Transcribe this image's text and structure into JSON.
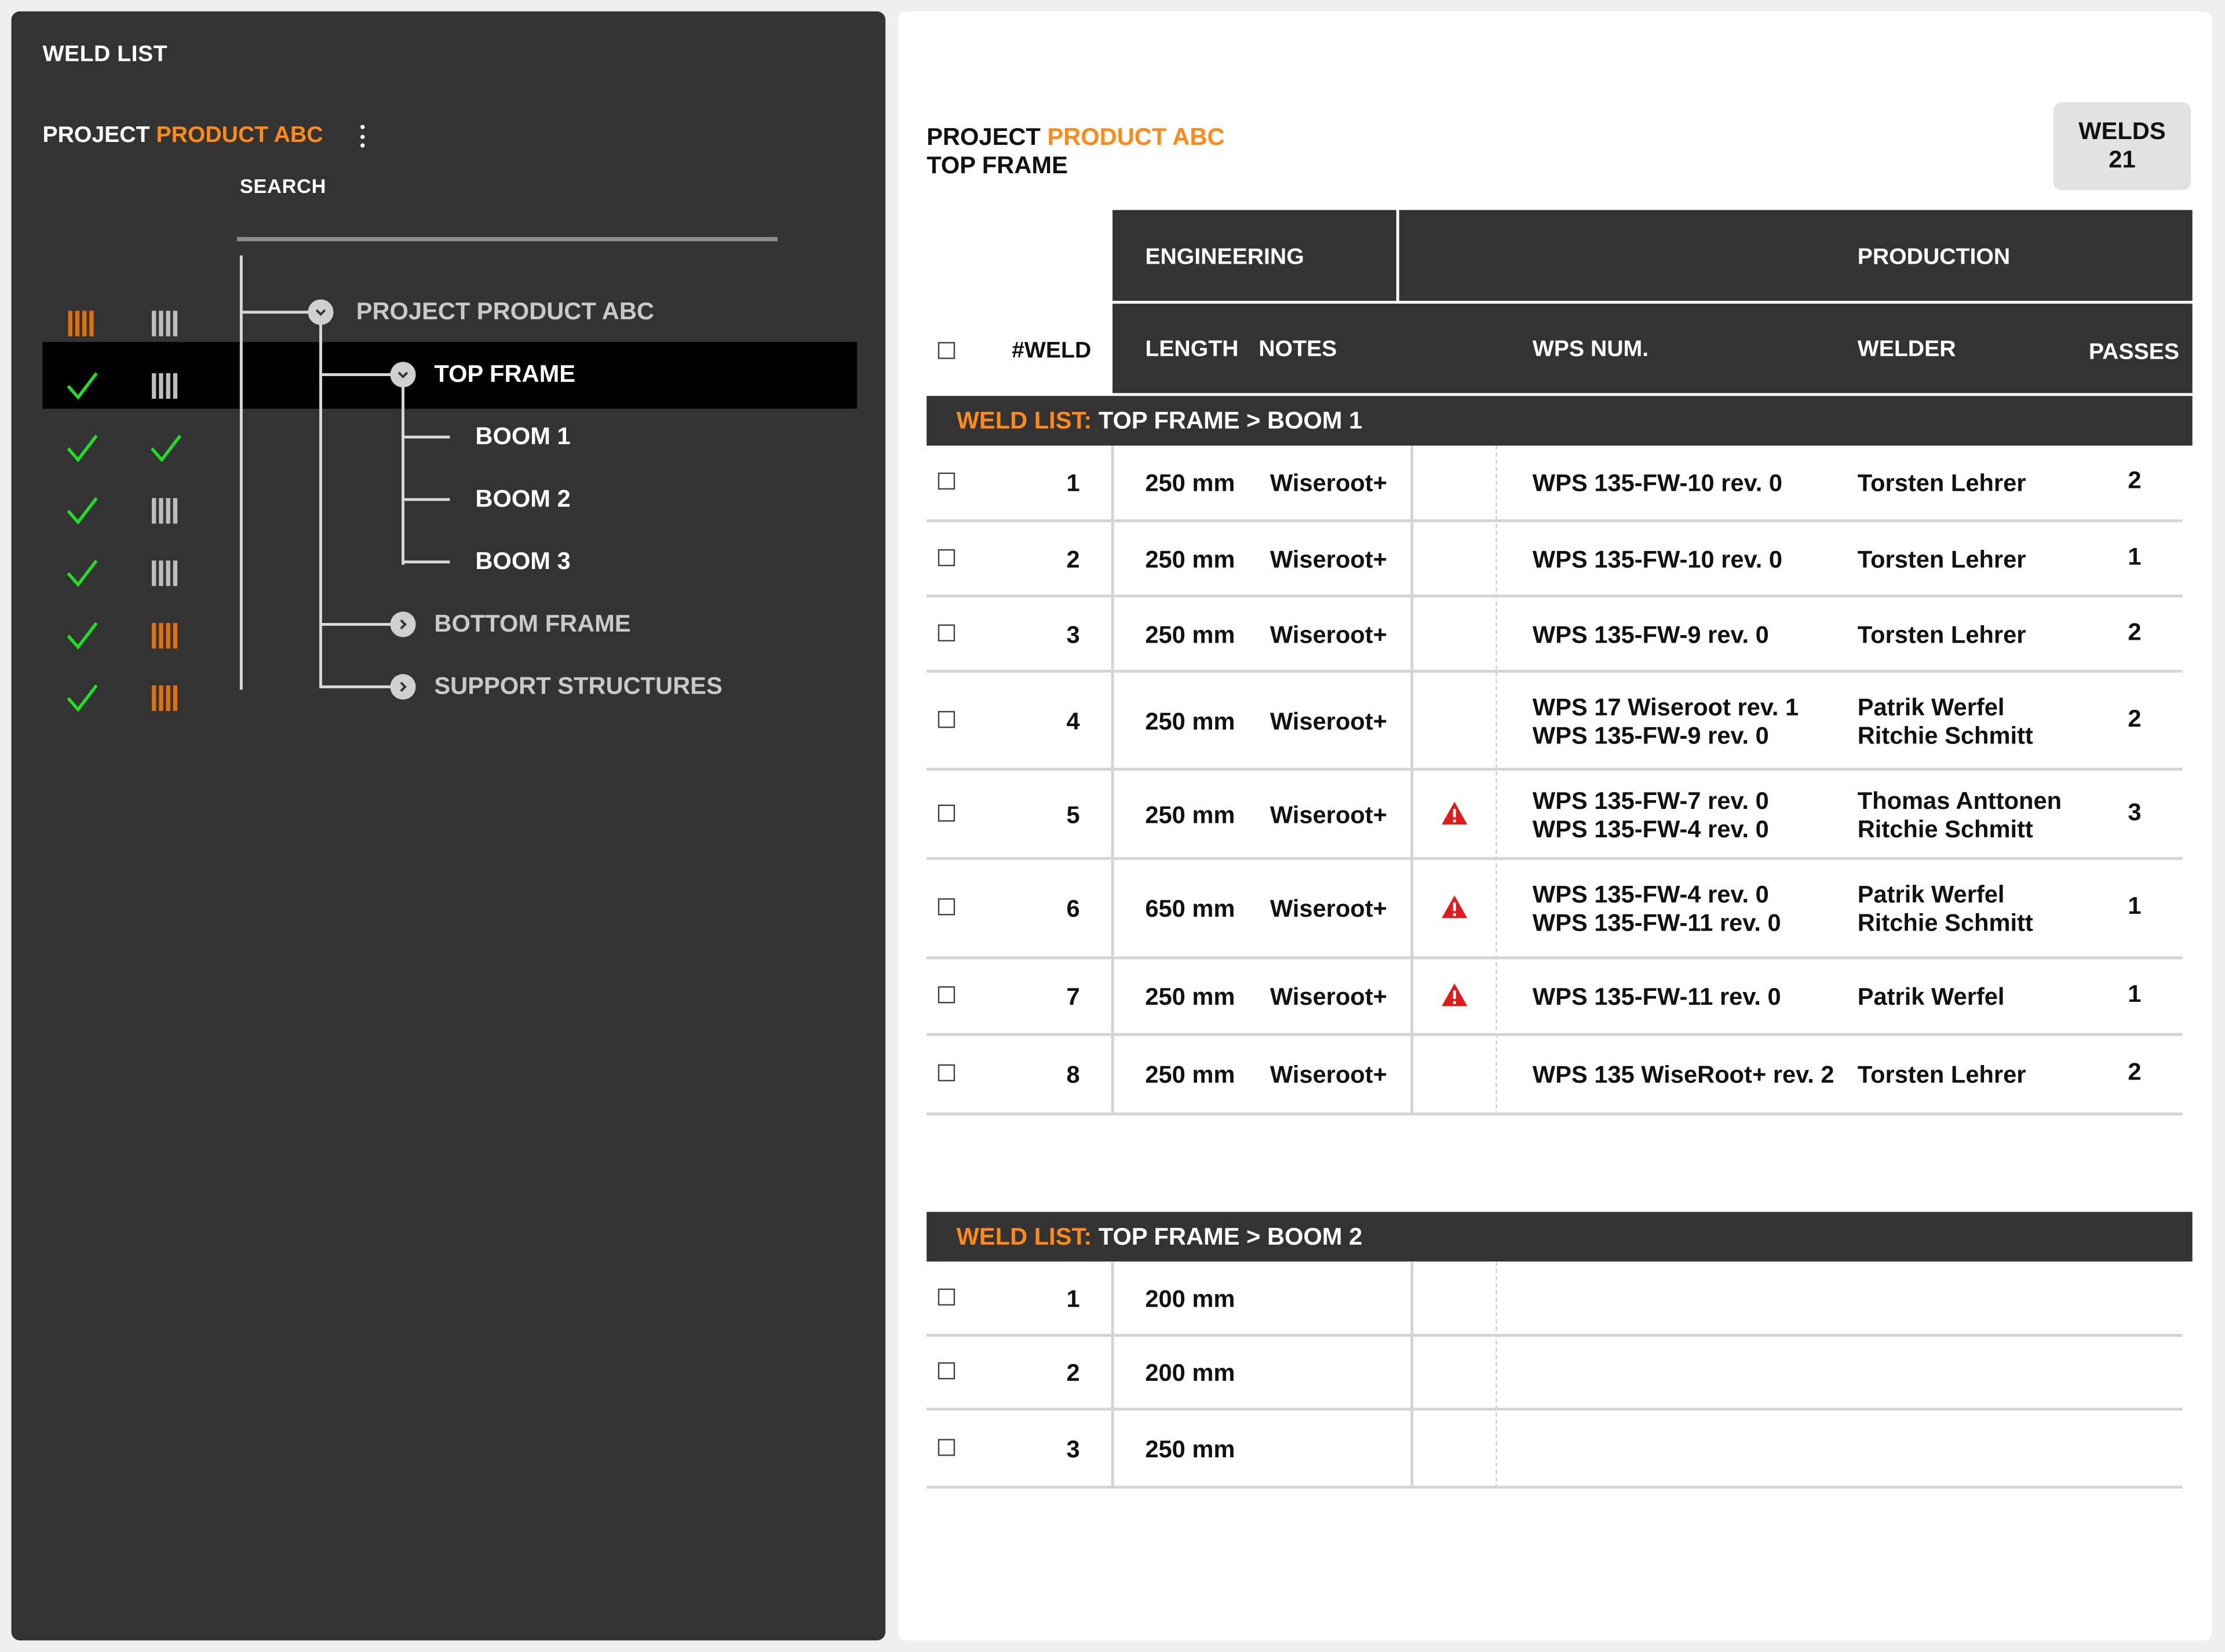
{
  "sidebar": {
    "title": "WELD LIST",
    "project_prefix": "PROJECT",
    "project_name": "PRODUCT ABC",
    "search_label": "SEARCH",
    "search_value": "",
    "tree": {
      "root": "PROJECT PRODUCT ABC",
      "top_frame": "TOP FRAME",
      "boom1": "BOOM 1",
      "boom2": "BOOM 2",
      "boom3": "BOOM 3",
      "bottom_frame": "BOTTOM FRAME",
      "support": "SUPPORT STRUCTURES"
    },
    "status_rows": [
      {
        "engineering": "barcode-orange-icon",
        "production": "barcode-gray-icon"
      },
      {
        "engineering": "check-icon",
        "production": "barcode-gray-icon"
      },
      {
        "engineering": "check-icon",
        "production": "check-icon"
      },
      {
        "engineering": "check-icon",
        "production": "barcode-gray-icon"
      },
      {
        "engineering": "check-icon",
        "production": "barcode-gray-icon"
      },
      {
        "engineering": "check-icon",
        "production": "barcode-orange-icon"
      },
      {
        "engineering": "check-icon",
        "production": "barcode-orange-icon"
      }
    ]
  },
  "main": {
    "project_prefix": "PROJECT",
    "project_name": "PRODUCT ABC",
    "subtitle": "TOP FRAME",
    "welds_label": "WELDS",
    "welds_count": "21",
    "group_engineering": "ENGINEERING",
    "group_production": "PRODUCTION",
    "columns": {
      "weld": "#WELD",
      "length": "LENGTH",
      "notes": "NOTES",
      "wps": "WPS NUM.",
      "welder": "WELDER",
      "passes": "PASSES"
    },
    "sections": [
      {
        "prefix": "WELD LIST:",
        "path": "TOP FRAME > BOOM 1",
        "rows": [
          {
            "num": "1",
            "length": "250 mm",
            "notes": "Wiseroot+",
            "warn": false,
            "wps": [
              "WPS 135-FW-10 rev. 0"
            ],
            "welder": [
              "Torsten Lehrer"
            ],
            "passes": "2"
          },
          {
            "num": "2",
            "length": "250 mm",
            "notes": "Wiseroot+",
            "warn": false,
            "wps": [
              "WPS 135-FW-10 rev. 0"
            ],
            "welder": [
              "Torsten Lehrer"
            ],
            "passes": "1"
          },
          {
            "num": "3",
            "length": "250 mm",
            "notes": "Wiseroot+",
            "warn": false,
            "wps": [
              "WPS 135-FW-9 rev. 0"
            ],
            "welder": [
              "Torsten Lehrer"
            ],
            "passes": "2"
          },
          {
            "num": "4",
            "length": "250 mm",
            "notes": "Wiseroot+",
            "warn": false,
            "wps": [
              "WPS 17 Wiseroot rev. 1",
              "WPS 135-FW-9 rev. 0"
            ],
            "welder": [
              "Patrik Werfel",
              "Ritchie Schmitt"
            ],
            "passes": "2"
          },
          {
            "num": "5",
            "length": "250 mm",
            "notes": "Wiseroot+",
            "warn": true,
            "wps": [
              "WPS 135-FW-7 rev. 0",
              "WPS 135-FW-4 rev. 0"
            ],
            "welder": [
              "Thomas Anttonen",
              "Ritchie Schmitt"
            ],
            "passes": "3"
          },
          {
            "num": "6",
            "length": "650 mm",
            "notes": "Wiseroot+",
            "warn": true,
            "wps": [
              "WPS 135-FW-4 rev. 0",
              "WPS 135-FW-11 rev. 0"
            ],
            "welder": [
              "Patrik Werfel",
              "Ritchie Schmitt"
            ],
            "passes": "1"
          },
          {
            "num": "7",
            "length": "250 mm",
            "notes": "Wiseroot+",
            "warn": true,
            "wps": [
              "WPS 135-FW-11 rev. 0"
            ],
            "welder": [
              "Patrik Werfel"
            ],
            "passes": "1"
          },
          {
            "num": "8",
            "length": "250 mm",
            "notes": "Wiseroot+",
            "warn": false,
            "wps": [
              "WPS 135 WiseRoot+ rev. 2"
            ],
            "welder": [
              "Torsten Lehrer"
            ],
            "passes": "2"
          }
        ]
      },
      {
        "prefix": "WELD LIST:",
        "path": "TOP FRAME > BOOM 2",
        "rows": [
          {
            "num": "1",
            "length": "200 mm"
          },
          {
            "num": "2",
            "length": "200 mm"
          },
          {
            "num": "3",
            "length": "250 mm"
          }
        ]
      }
    ]
  },
  "colors": {
    "accent": "#ff8a1a",
    "panel_dark": "#333333",
    "check": "#22e022",
    "warning": "#e01b1b"
  }
}
